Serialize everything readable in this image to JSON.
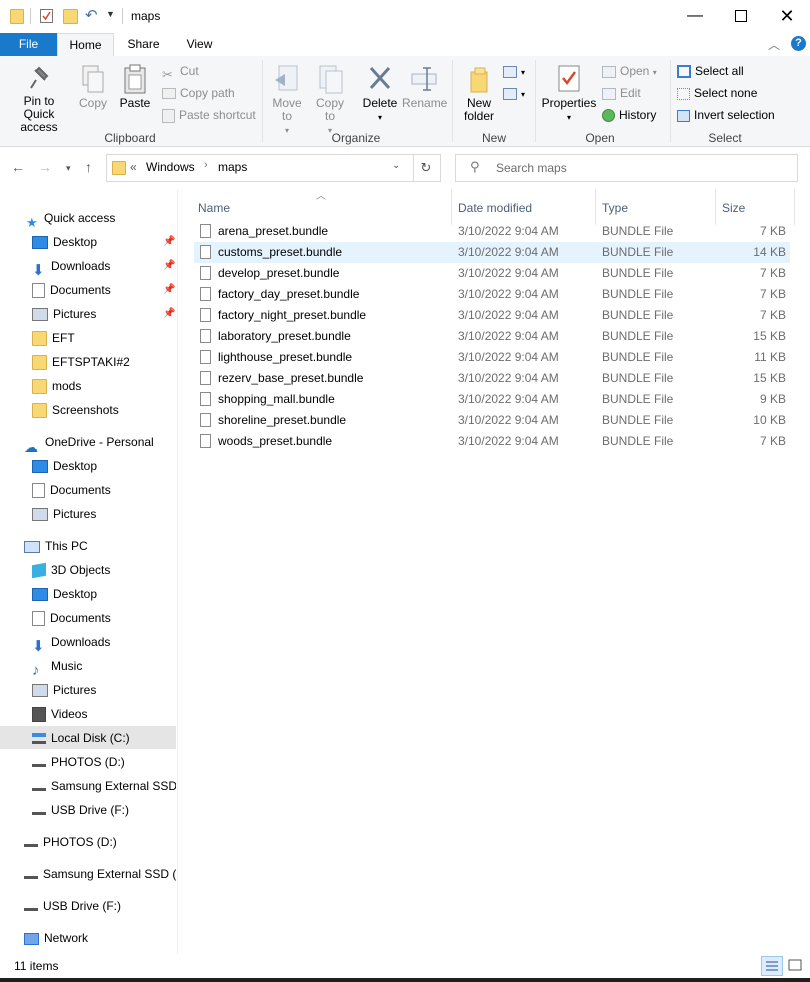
{
  "window": {
    "title": "maps"
  },
  "ribbon_tabs": [
    "File",
    "Home",
    "Share",
    "View"
  ],
  "ribbon": {
    "clipboard": {
      "pin": "Pin to Quick access",
      "copy": "Copy",
      "paste": "Paste",
      "cut": "Cut",
      "copy_path": "Copy path",
      "paste_shortcut": "Paste shortcut",
      "label": "Clipboard"
    },
    "organize": {
      "move_to": "Move to",
      "copy_to": "Copy to",
      "delete": "Delete",
      "rename": "Rename",
      "label": "Organize"
    },
    "new": {
      "new_folder": "New folder",
      "label": "New"
    },
    "open": {
      "properties": "Properties",
      "open": "Open",
      "edit": "Edit",
      "history": "History",
      "label": "Open"
    },
    "select": {
      "select_all": "Select all",
      "select_none": "Select none",
      "invert_selection": "Invert selection",
      "label": "Select"
    }
  },
  "address": {
    "overflow": "«",
    "crumbs": [
      "Windows",
      "maps"
    ],
    "search_placeholder": "Search maps"
  },
  "sidebar": {
    "quick_access": {
      "label": "Quick access",
      "items": [
        "Desktop",
        "Downloads",
        "Documents",
        "Pictures",
        "EFT",
        "EFTSPTAKI#2",
        "mods",
        "Screenshots"
      ]
    },
    "onedrive": {
      "label": "OneDrive - Personal",
      "items": [
        "Desktop",
        "Documents",
        "Pictures"
      ]
    },
    "this_pc": {
      "label": "This PC",
      "items": [
        "3D Objects",
        "Desktop",
        "Documents",
        "Downloads",
        "Music",
        "Pictures",
        "Videos",
        "Local Disk (C:)",
        "PHOTOS (D:)",
        "Samsung External SSD (",
        "USB Drive (F:)"
      ]
    },
    "drives": [
      "PHOTOS (D:)",
      "Samsung External SSD (E",
      "USB Drive (F:)"
    ],
    "network": "Network"
  },
  "columns": {
    "name": "Name",
    "date": "Date modified",
    "type": "Type",
    "size": "Size"
  },
  "files": [
    {
      "name": "arena_preset.bundle",
      "date": "3/10/2022 9:04 AM",
      "type": "BUNDLE File",
      "size": "7 KB"
    },
    {
      "name": "customs_preset.bundle",
      "date": "3/10/2022 9:04 AM",
      "type": "BUNDLE File",
      "size": "14 KB"
    },
    {
      "name": "develop_preset.bundle",
      "date": "3/10/2022 9:04 AM",
      "type": "BUNDLE File",
      "size": "7 KB"
    },
    {
      "name": "factory_day_preset.bundle",
      "date": "3/10/2022 9:04 AM",
      "type": "BUNDLE File",
      "size": "7 KB"
    },
    {
      "name": "factory_night_preset.bundle",
      "date": "3/10/2022 9:04 AM",
      "type": "BUNDLE File",
      "size": "7 KB"
    },
    {
      "name": "laboratory_preset.bundle",
      "date": "3/10/2022 9:04 AM",
      "type": "BUNDLE File",
      "size": "15 KB"
    },
    {
      "name": "lighthouse_preset.bundle",
      "date": "3/10/2022 9:04 AM",
      "type": "BUNDLE File",
      "size": "11 KB"
    },
    {
      "name": "rezerv_base_preset.bundle",
      "date": "3/10/2022 9:04 AM",
      "type": "BUNDLE File",
      "size": "15 KB"
    },
    {
      "name": "shopping_mall.bundle",
      "date": "3/10/2022 9:04 AM",
      "type": "BUNDLE File",
      "size": "9 KB"
    },
    {
      "name": "shoreline_preset.bundle",
      "date": "3/10/2022 9:04 AM",
      "type": "BUNDLE File",
      "size": "10 KB"
    },
    {
      "name": "woods_preset.bundle",
      "date": "3/10/2022 9:04 AM",
      "type": "BUNDLE File",
      "size": "7 KB"
    }
  ],
  "status": {
    "items_count": "11 items"
  },
  "colors": {
    "accent": "#1979ca",
    "selection": "#e5f3ff",
    "sidebar_selected": "#e5e5e5"
  }
}
